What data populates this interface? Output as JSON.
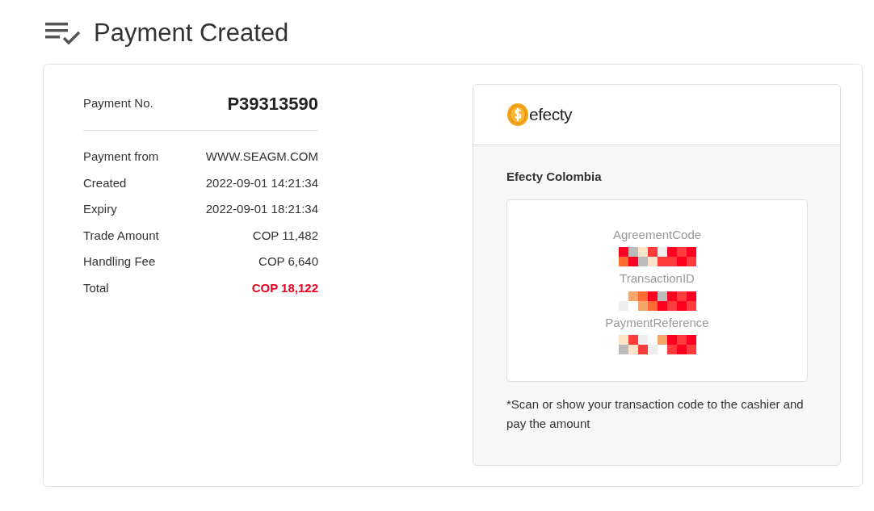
{
  "page": {
    "title": "Payment Created"
  },
  "payment": {
    "number_label": "Payment No.",
    "number": "P39313590",
    "details": [
      {
        "label": "Payment from",
        "value": "WWW.SEAGM.COM",
        "highlight": false
      },
      {
        "label": "Created",
        "value": "2022-09-01 14:21:34",
        "highlight": false
      },
      {
        "label": "Expiry",
        "value": "2022-09-01 18:21:34",
        "highlight": false
      },
      {
        "label": "Trade Amount",
        "value": "COP 11,482",
        "highlight": false
      },
      {
        "label": "Handling Fee",
        "value": "COP 6,640",
        "highlight": false
      },
      {
        "label": "Total",
        "value": "COP 18,122",
        "highlight": true
      }
    ]
  },
  "method": {
    "logo_text": "efecty",
    "name": "Efecty Colombia",
    "codes": [
      {
        "label": "AgreementCode"
      },
      {
        "label": "TransactionID"
      },
      {
        "label": "PaymentReference"
      }
    ],
    "note": "*Scan or show your transaction code to the cashier and pay the amount"
  }
}
